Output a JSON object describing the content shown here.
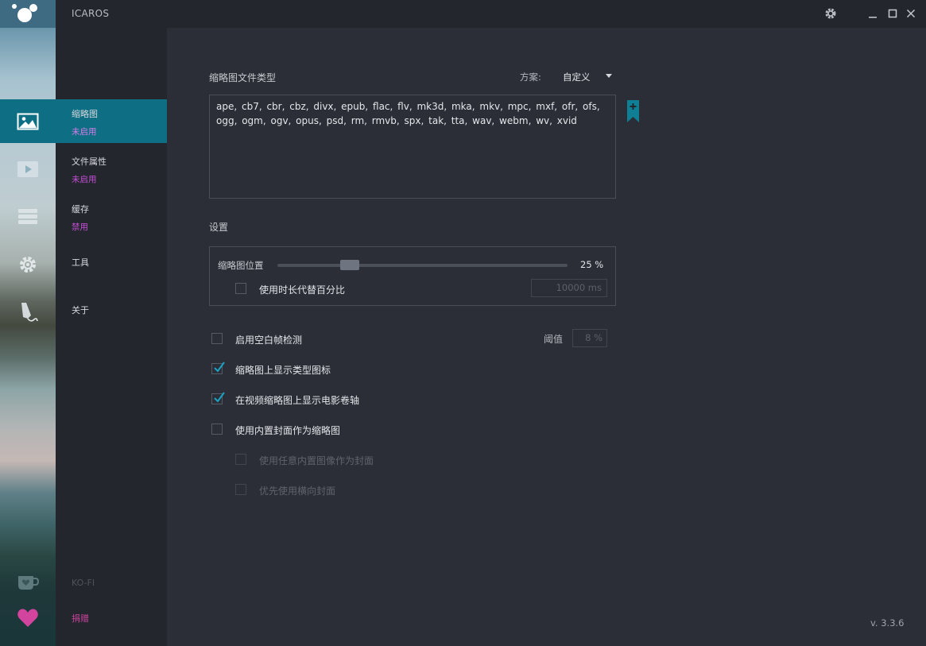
{
  "app": {
    "title": "ICAROS",
    "version": "v. 3.3.6"
  },
  "titlebar": {
    "settings_icon": "gear-icon",
    "minimize_icon": "minimize-icon",
    "maximize_icon": "maximize-icon",
    "close_icon": "close-icon"
  },
  "rail": {
    "icons": [
      "image-icon",
      "play-icon",
      "stack-icon",
      "gear-icon",
      "pen-icon",
      "coffee-cup-icon",
      "heart-icon"
    ],
    "active_color": "#0e6f84"
  },
  "nav": {
    "items": [
      {
        "title": "缩略图",
        "status": "未启用"
      },
      {
        "title": "文件属性",
        "status": "未启用"
      },
      {
        "title": "缓存",
        "status": "禁用"
      },
      {
        "title": "工具"
      },
      {
        "title": "关于"
      }
    ],
    "kofi": "KO-FI",
    "donate": "捐赠"
  },
  "thumbnails": {
    "types_label": "缩略图文件类型",
    "scheme_label": "方案:",
    "scheme_value": "自定义",
    "file_types": "ape,  cb7,  cbr,  cbz,  divx,  epub,  flac,  flv,  mk3d,  mka,  mkv,  mpc,  mxf,  ofr,  ofs,  ogg,  ogm,  ogv,  opus,  psd,  rm,  rmvb,  spx,  tak,  tta,  wav,  webm,  wv,  xvid"
  },
  "settings": {
    "label": "设置",
    "position_label": "缩略图位置",
    "position_value": "25 %",
    "position_fraction": 0.25,
    "use_duration_label": "使用时长代替百分比",
    "use_duration_checked": false,
    "duration_value": "10000 ms"
  },
  "options": {
    "blank_frame": {
      "label": "启用空白帧检测",
      "checked": false
    },
    "threshold_label": "阈值",
    "threshold_value": "8 %",
    "type_icon": {
      "label": "缩略图上显示类型图标",
      "checked": true
    },
    "film_strip": {
      "label": "在视频缩略图上显示电影卷轴",
      "checked": true
    },
    "embedded_cover": {
      "label": "使用内置封面作为缩略图",
      "checked": false
    },
    "any_embedded": {
      "label": "使用任意内置图像作为封面",
      "checked": false,
      "disabled": true
    },
    "prefer_landscape": {
      "label": "优先使用横向封面",
      "checked": false,
      "disabled": true
    }
  }
}
